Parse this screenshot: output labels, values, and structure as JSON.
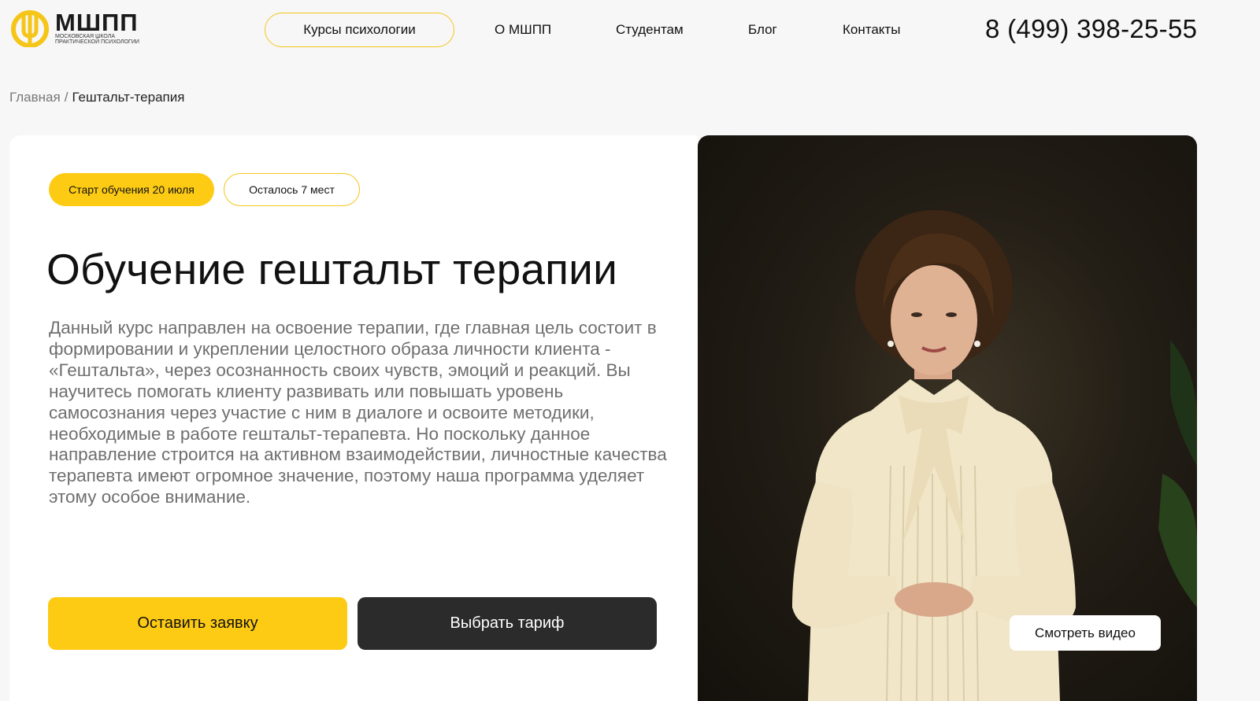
{
  "header": {
    "logo": {
      "name": "МШПП",
      "subtitle": "Московская школа практической психологии"
    },
    "nav": {
      "courses": "Курсы психологии",
      "about": "О МШПП",
      "students": "Студентам",
      "blog": "Блог",
      "contacts": "Контакты"
    },
    "phone": "8 (499) 398-25-55"
  },
  "breadcrumb": {
    "home": "Главная",
    "separator": "/",
    "current": "Гештальт-терапия"
  },
  "hero": {
    "badge_start": "Старт обучения 20 июля",
    "badge_seats": "Осталось 7 мест",
    "title": "Обучение гештальт терапии",
    "description": "Данный курс направлен на освоение терапии, где главная цель состоит в формировании и укреплении целостного образа личности клиента - «Гештальта», через осознанность своих чувств, эмоций и реакций. Вы научитесь помогать клиенту развивать или повышать уровень самосознания через участие с ним в диалоге и освоите методики, необходимые в работе гештальт-терапевта. Но поскольку данное направление строится на активном взаимодействии, личностные качества терапевта имеют огромное значение, поэтому наша программа уделяет этому особое внимание.",
    "apply_button": "Оставить заявку",
    "tariff_button": "Выбрать тариф",
    "watch_video_button": "Смотреть видео"
  },
  "colors": {
    "accent": "#fdcb14",
    "dark_button": "#2b2b2b",
    "background": "#f7f7f7"
  }
}
